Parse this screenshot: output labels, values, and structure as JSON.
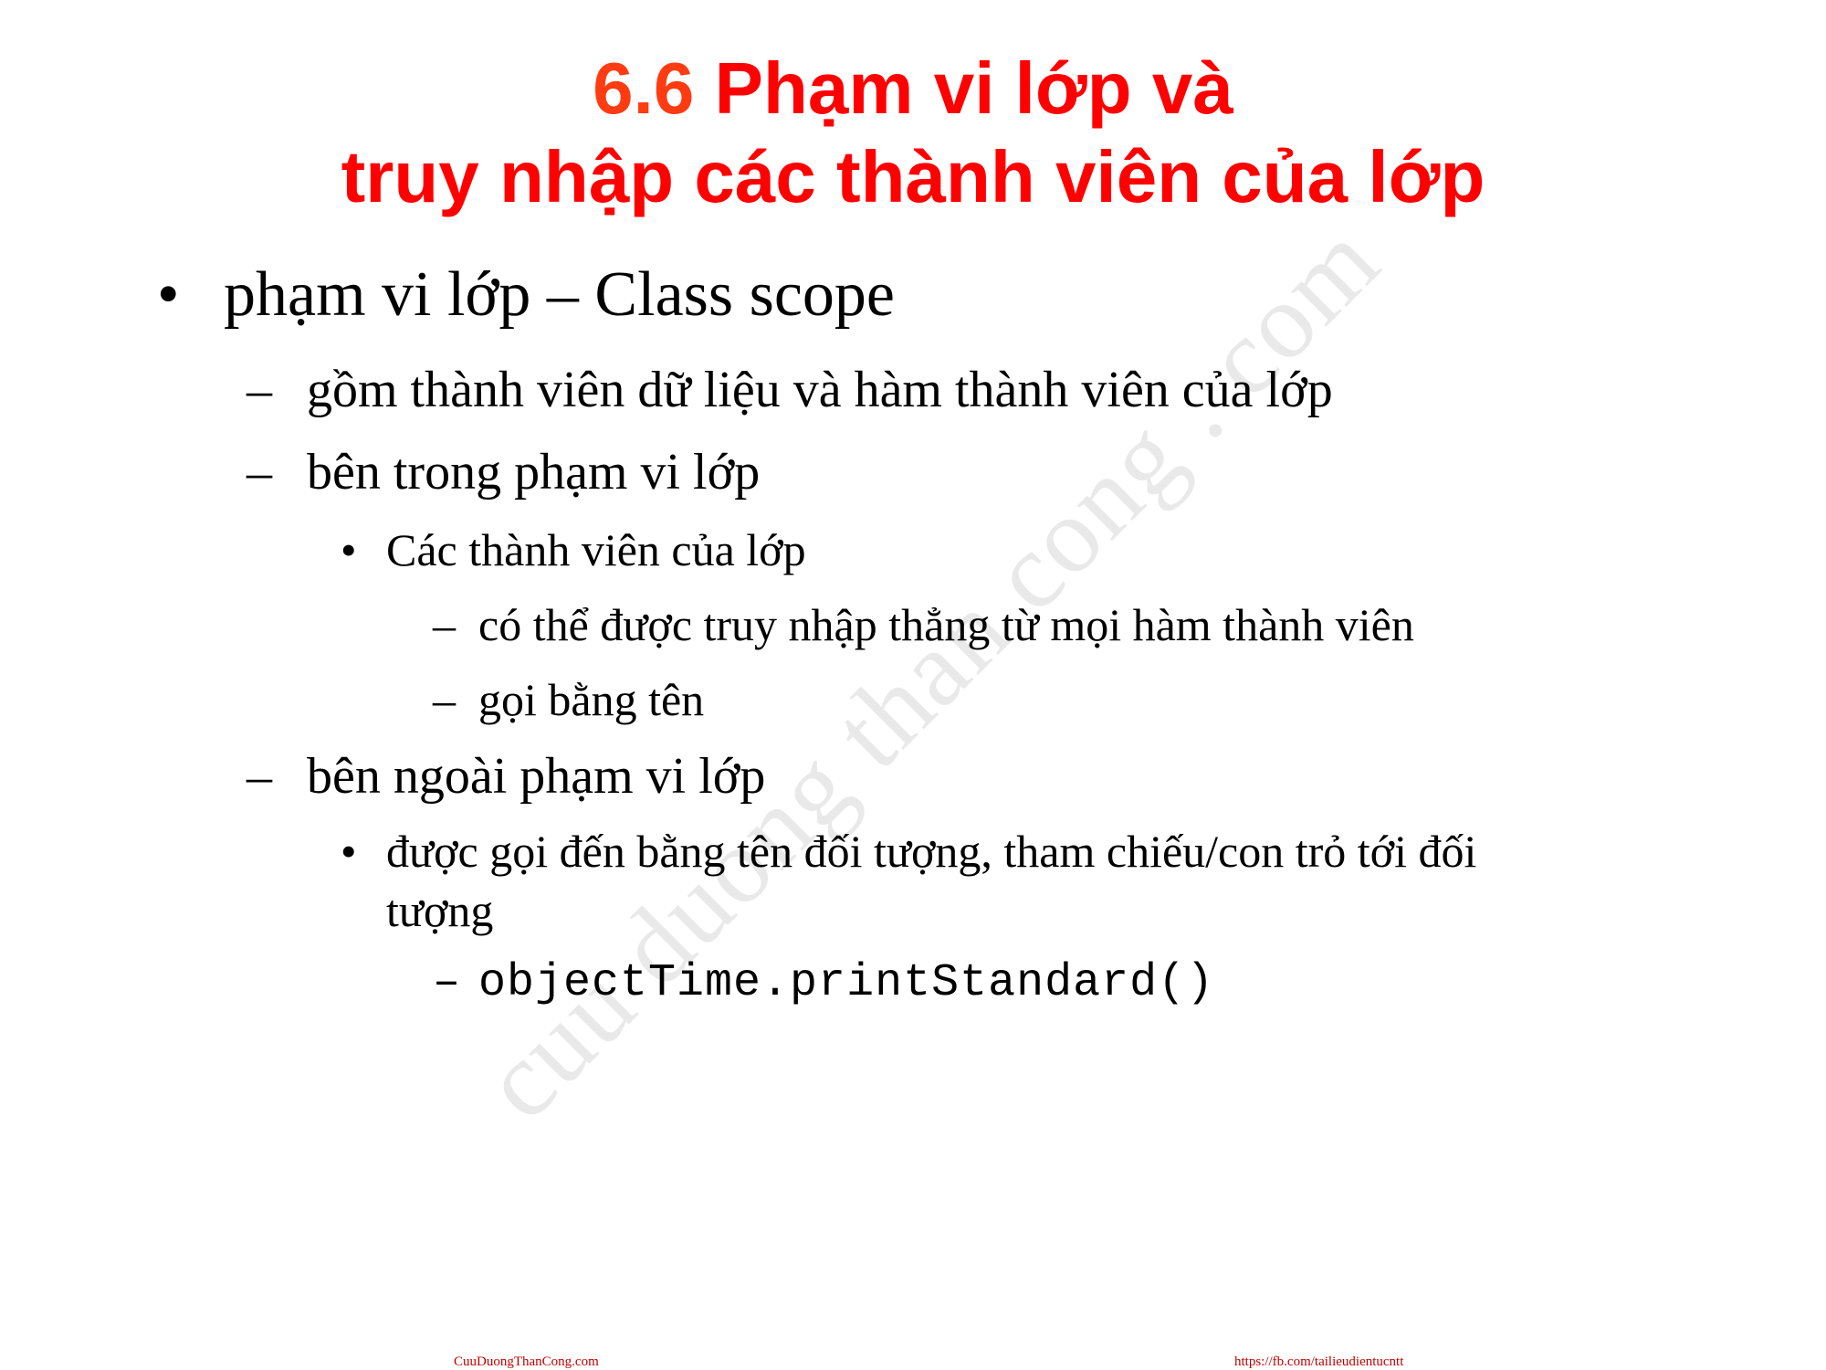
{
  "title": {
    "number": "6.6",
    "line1": "Phạm vi lớp và",
    "line2": "truy nhập các thành viên của lớp"
  },
  "watermark": "cuu duong than cong . com",
  "content": {
    "bullet1": {
      "marker": "•",
      "text": "phạm vi lớp – Class scope"
    },
    "sub1": {
      "marker": "–",
      "text": "gồm thành viên dữ liệu và hàm thành viên của lớp"
    },
    "sub2": {
      "marker": "–",
      "text": "bên trong phạm vi lớp"
    },
    "sub2_bullet": {
      "marker": "•",
      "text": "Các thành viên của lớp"
    },
    "sub2_dash1": {
      "marker": "–",
      "text": "có thể được truy nhập thẳng từ mọi hàm thành viên"
    },
    "sub2_dash2": {
      "marker": "–",
      "text": "gọi bằng tên"
    },
    "sub3": {
      "marker": "–",
      "text": "bên ngoài phạm vi lớp"
    },
    "sub3_bullet": {
      "marker": "•",
      "line1": "được gọi đến bằng tên đối tượng, tham chiếu/con trỏ tới đối",
      "line2": "tượng"
    },
    "code_line": {
      "marker": "–",
      "text": "objectTime.printStandard()"
    }
  },
  "footer": {
    "left": "CuuDuongThanCong.com",
    "right": "https://fb.com/tailieudientucntt"
  },
  "colors": {
    "title_number": "#ff3b12",
    "title_text": "#ff0000",
    "footer": "#c00000",
    "watermark": "#e9e9e9"
  }
}
